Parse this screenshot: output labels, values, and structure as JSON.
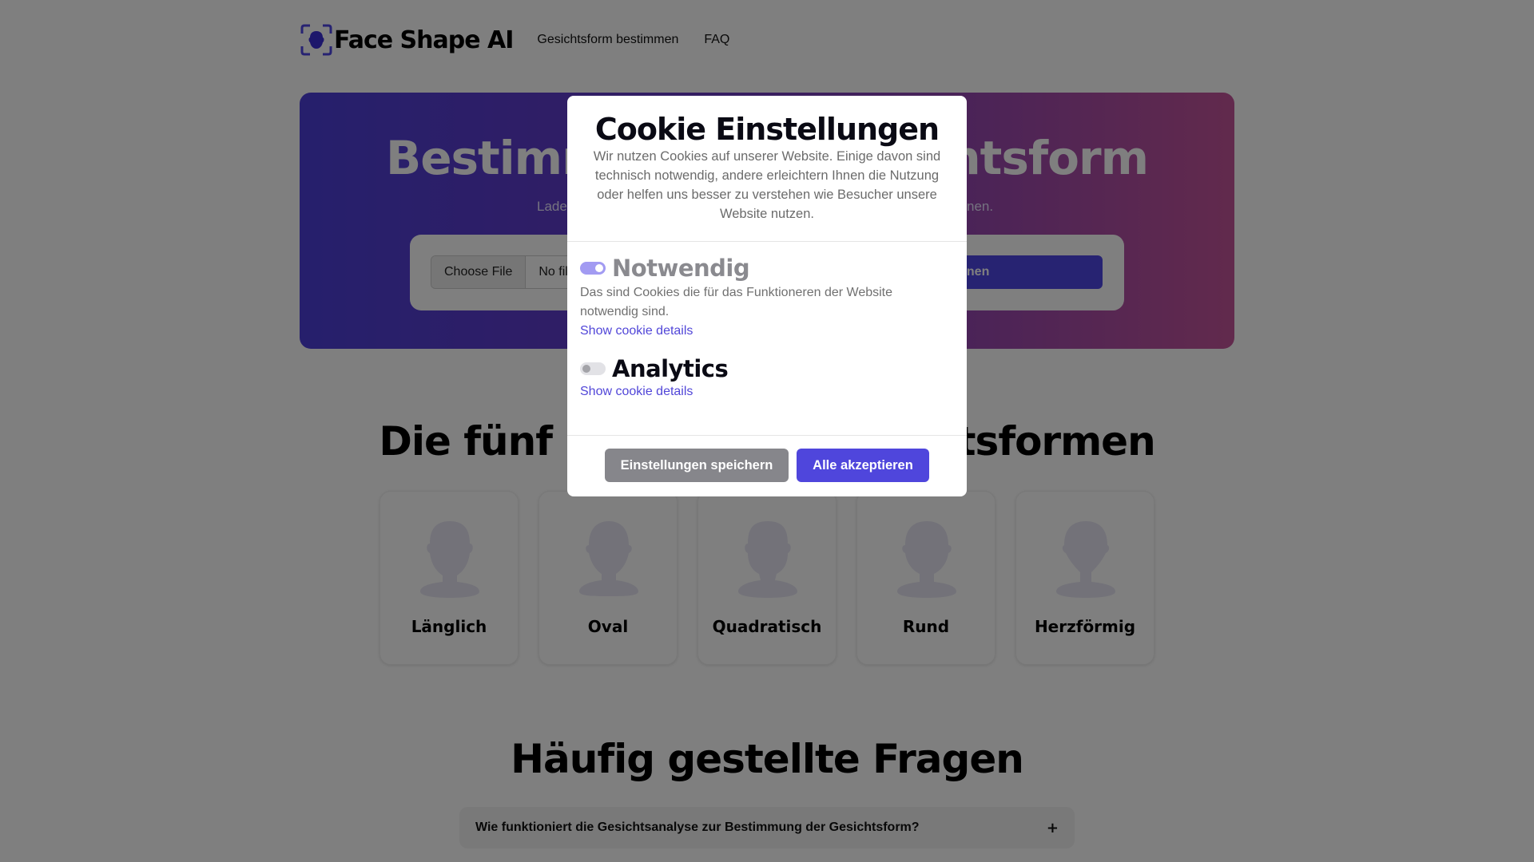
{
  "header": {
    "logo_text": "Face Shape AI",
    "nav": [
      {
        "label": "Gesichtsform bestimmen"
      },
      {
        "label": "FAQ"
      }
    ]
  },
  "hero": {
    "title": "Bestimme deine Gesichtsform",
    "subtitle_fragment_left": "Lade",
    "subtitle_fragment_right": "nen.",
    "file_button_label": "Choose File",
    "file_name_text": "No file chosen",
    "scan_button_label": "Scannen"
  },
  "shapes": {
    "title": "Die fünf häufigsten Gesichtsformen",
    "cards": [
      {
        "label": "Länglich",
        "icon": "face-silhouette-icon"
      },
      {
        "label": "Oval",
        "icon": "face-silhouette-icon"
      },
      {
        "label": "Quadratisch",
        "icon": "face-silhouette-icon"
      },
      {
        "label": "Rund",
        "icon": "face-silhouette-icon"
      },
      {
        "label": "Herzförmig",
        "icon": "face-silhouette-icon"
      }
    ]
  },
  "faq": {
    "title": "Häufig gestellte Fragen",
    "items": [
      {
        "question": "Wie funktioniert die Gesichtsanalyse zur Bestimmung der Gesichtsform?",
        "expand_symbol": "+"
      }
    ]
  },
  "cookie_modal": {
    "title": "Cookie Einstellungen",
    "description": "Wir nutzen Cookies auf unserer Website. Einige davon sind technisch notwendig, andere erleichtern Ihnen die Nutzung oder helfen uns besser zu verstehen wie Besucher unsere Website nutzen.",
    "categories": [
      {
        "title": "Notwendig",
        "enabled": true,
        "locked": true,
        "description": "Das sind Cookies die für das Funktioneren der Website notwendig sind.",
        "details_link": "Show cookie details"
      },
      {
        "title": "Analytics",
        "enabled": false,
        "locked": false,
        "description": "",
        "details_link": "Show cookie details"
      }
    ],
    "save_button_label": "Einstellungen speichern",
    "accept_all_button_label": "Alle akzeptieren"
  },
  "colors": {
    "accent": "#4f46e5",
    "toggle_on": "#a29bf2",
    "link": "#5146d8",
    "hero_gradient_start": "#4c3fd9",
    "hero_gradient_end": "#c4549a",
    "overlay": "rgba(0,0,0,0.5)"
  }
}
